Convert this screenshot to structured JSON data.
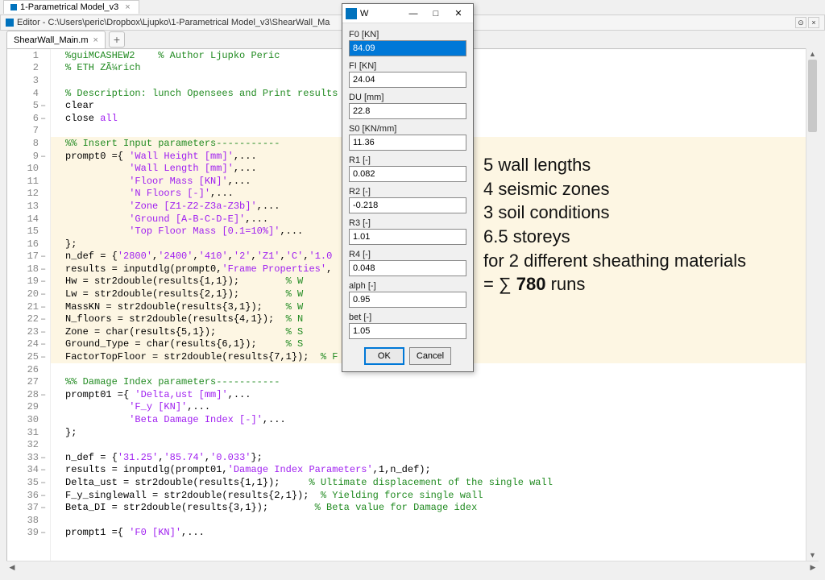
{
  "outerTab": "1-Parametrical Model_v3",
  "editor": {
    "title": "Editor - C:\\Users\\peric\\Dropbox\\Ljupko\\1-Parametrical Model_v3\\ShearWall_Ma",
    "restoreTip": "⊙",
    "closeTip": "×"
  },
  "fileTab": {
    "name": "ShearWall_Main.m",
    "close": "×",
    "plus": "+"
  },
  "code": [
    {
      "n": 1,
      "dash": false,
      "hl": false,
      "spans": [
        [
          "com",
          "%guiMCASHEW2    % Author Ljupko Peric"
        ]
      ]
    },
    {
      "n": 2,
      "dash": false,
      "hl": false,
      "spans": [
        [
          "com",
          "% ETH ZÃ¼rich"
        ]
      ]
    },
    {
      "n": 3,
      "dash": false,
      "hl": false,
      "spans": [
        [
          "txt",
          ""
        ]
      ]
    },
    {
      "n": 4,
      "dash": false,
      "hl": false,
      "spans": [
        [
          "com",
          "% Description: lunch Opensees and Print results"
        ]
      ]
    },
    {
      "n": 5,
      "dash": true,
      "hl": false,
      "spans": [
        [
          "txt",
          "clear"
        ]
      ]
    },
    {
      "n": 6,
      "dash": true,
      "hl": false,
      "spans": [
        [
          "txt",
          "close "
        ],
        [
          "str",
          "all"
        ]
      ]
    },
    {
      "n": 7,
      "dash": false,
      "hl": false,
      "spans": [
        [
          "txt",
          ""
        ]
      ]
    },
    {
      "n": 8,
      "dash": false,
      "hl": true,
      "spans": [
        [
          "com",
          "%% Insert Input parameters-----------"
        ]
      ]
    },
    {
      "n": 9,
      "dash": true,
      "hl": true,
      "spans": [
        [
          "txt",
          "prompt0 ={ "
        ],
        [
          "str",
          "'Wall Height [mm]'"
        ],
        [
          "txt",
          ",..."
        ]
      ]
    },
    {
      "n": 10,
      "dash": false,
      "hl": true,
      "spans": [
        [
          "txt",
          "           "
        ],
        [
          "str",
          "'Wall Length [mm]'"
        ],
        [
          "txt",
          ",..."
        ]
      ]
    },
    {
      "n": 11,
      "dash": false,
      "hl": true,
      "spans": [
        [
          "txt",
          "           "
        ],
        [
          "str",
          "'Floor Mass [KN]'"
        ],
        [
          "txt",
          ",..."
        ]
      ]
    },
    {
      "n": 12,
      "dash": false,
      "hl": true,
      "spans": [
        [
          "txt",
          "           "
        ],
        [
          "str",
          "'N Floors [-]'"
        ],
        [
          "txt",
          ",..."
        ]
      ]
    },
    {
      "n": 13,
      "dash": false,
      "hl": true,
      "spans": [
        [
          "txt",
          "           "
        ],
        [
          "str",
          "'Zone [Z1-Z2-Z3a-Z3b]'"
        ],
        [
          "txt",
          ",..."
        ]
      ]
    },
    {
      "n": 14,
      "dash": false,
      "hl": true,
      "spans": [
        [
          "txt",
          "           "
        ],
        [
          "str",
          "'Ground [A-B-C-D-E]'"
        ],
        [
          "txt",
          ",..."
        ]
      ]
    },
    {
      "n": 15,
      "dash": false,
      "hl": true,
      "spans": [
        [
          "txt",
          "           "
        ],
        [
          "str",
          "'Top Floor Mass [0.1=10%]'"
        ],
        [
          "txt",
          ",..."
        ]
      ]
    },
    {
      "n": 16,
      "dash": false,
      "hl": true,
      "spans": [
        [
          "txt",
          "};"
        ]
      ]
    },
    {
      "n": 17,
      "dash": true,
      "hl": true,
      "spans": [
        [
          "txt",
          "n_def = {"
        ],
        [
          "str",
          "'2800'"
        ],
        [
          "txt",
          ","
        ],
        [
          "str",
          "'2400'"
        ],
        [
          "txt",
          ","
        ],
        [
          "str",
          "'410'"
        ],
        [
          "txt",
          ","
        ],
        [
          "str",
          "'2'"
        ],
        [
          "txt",
          ","
        ],
        [
          "str",
          "'Z1'"
        ],
        [
          "txt",
          ","
        ],
        [
          "str",
          "'C'"
        ],
        [
          "txt",
          ","
        ],
        [
          "str",
          "'1.0"
        ]
      ]
    },
    {
      "n": 18,
      "dash": true,
      "hl": true,
      "spans": [
        [
          "txt",
          "results = inputdlg(prompt0,"
        ],
        [
          "str",
          "'Frame Properties'"
        ],
        [
          "txt",
          ","
        ]
      ]
    },
    {
      "n": 19,
      "dash": true,
      "hl": true,
      "spans": [
        [
          "txt",
          "Hw = str2double(results{1,1});        "
        ],
        [
          "com",
          "% W"
        ]
      ]
    },
    {
      "n": 20,
      "dash": true,
      "hl": true,
      "spans": [
        [
          "txt",
          "Lw = str2double(results{2,1});        "
        ],
        [
          "com",
          "% W"
        ]
      ]
    },
    {
      "n": 21,
      "dash": true,
      "hl": true,
      "spans": [
        [
          "txt",
          "MassKN = str2double(results{3,1});    "
        ],
        [
          "com",
          "% W"
        ]
      ]
    },
    {
      "n": 22,
      "dash": true,
      "hl": true,
      "spans": [
        [
          "txt",
          "N_floors = str2double(results{4,1});  "
        ],
        [
          "com",
          "% N"
        ]
      ]
    },
    {
      "n": 23,
      "dash": true,
      "hl": true,
      "spans": [
        [
          "txt",
          "Zone = char(results{5,1});            "
        ],
        [
          "com",
          "% S"
        ]
      ]
    },
    {
      "n": 24,
      "dash": true,
      "hl": true,
      "spans": [
        [
          "txt",
          "Ground_Type = char(results{6,1});     "
        ],
        [
          "com",
          "% S"
        ]
      ]
    },
    {
      "n": 25,
      "dash": true,
      "hl": true,
      "spans": [
        [
          "txt",
          "FactorTopFloor = str2double(results{7,1});  "
        ],
        [
          "com",
          "% F"
        ]
      ]
    },
    {
      "n": 26,
      "dash": false,
      "hl": false,
      "spans": [
        [
          "txt",
          ""
        ]
      ]
    },
    {
      "n": 27,
      "dash": false,
      "hl": false,
      "spans": [
        [
          "com",
          "%% Damage Index parameters-----------"
        ]
      ]
    },
    {
      "n": 28,
      "dash": true,
      "hl": false,
      "spans": [
        [
          "txt",
          "prompt01 ={ "
        ],
        [
          "str",
          "'Delta,ust [mm]'"
        ],
        [
          "txt",
          ",..."
        ]
      ]
    },
    {
      "n": 29,
      "dash": false,
      "hl": false,
      "spans": [
        [
          "txt",
          "           "
        ],
        [
          "str",
          "'F_y [KN]'"
        ],
        [
          "txt",
          ",..."
        ]
      ]
    },
    {
      "n": 30,
      "dash": false,
      "hl": false,
      "spans": [
        [
          "txt",
          "           "
        ],
        [
          "str",
          "'Beta Damage Index [-]'"
        ],
        [
          "txt",
          ",..."
        ]
      ]
    },
    {
      "n": 31,
      "dash": false,
      "hl": false,
      "spans": [
        [
          "txt",
          "};"
        ]
      ]
    },
    {
      "n": 32,
      "dash": false,
      "hl": false,
      "spans": [
        [
          "txt",
          ""
        ]
      ]
    },
    {
      "n": 33,
      "dash": true,
      "hl": false,
      "spans": [
        [
          "txt",
          "n_def = {"
        ],
        [
          "str",
          "'31.25'"
        ],
        [
          "txt",
          ","
        ],
        [
          "str",
          "'85.74'"
        ],
        [
          "txt",
          ","
        ],
        [
          "str",
          "'0.033'"
        ],
        [
          "txt",
          "};"
        ]
      ]
    },
    {
      "n": 34,
      "dash": true,
      "hl": false,
      "spans": [
        [
          "txt",
          "results = inputdlg(prompt01,"
        ],
        [
          "str",
          "'Damage Index Parameters'"
        ],
        [
          "txt",
          ",1,n_def);"
        ]
      ]
    },
    {
      "n": 35,
      "dash": true,
      "hl": false,
      "spans": [
        [
          "txt",
          "Delta_ust = str2double(results{1,1});     "
        ],
        [
          "com",
          "% Ultimate displacement of the single wall"
        ]
      ]
    },
    {
      "n": 36,
      "dash": true,
      "hl": false,
      "spans": [
        [
          "txt",
          "F_y_singlewall = str2double(results{2,1});  "
        ],
        [
          "com",
          "% Yielding force single wall"
        ]
      ]
    },
    {
      "n": 37,
      "dash": true,
      "hl": false,
      "spans": [
        [
          "txt",
          "Beta_DI = str2double(results{3,1});        "
        ],
        [
          "com",
          "% Beta value for Damage idex"
        ]
      ]
    },
    {
      "n": 38,
      "dash": false,
      "hl": false,
      "spans": [
        [
          "txt",
          ""
        ]
      ]
    },
    {
      "n": 39,
      "dash": true,
      "hl": false,
      "spans": [
        [
          "txt",
          "prompt1 ={ "
        ],
        [
          "str",
          "'F0 [KN]'"
        ],
        [
          "txt",
          ",..."
        ]
      ]
    }
  ],
  "overlay": {
    "l1": "5 wall lengths",
    "l2": "4 seismic zones",
    "l3": "3 soil conditions",
    "l4": "6.5 storeys",
    "l5": "for 2 different sheathing materials",
    "l6a": "= ∑ ",
    "l6b": "780",
    "l6c": " runs"
  },
  "dialog": {
    "title": "W",
    "fields": [
      {
        "label": "F0 [KN]",
        "value": "84.09",
        "sel": true
      },
      {
        "label": "FI [KN]",
        "value": "24.04"
      },
      {
        "label": "DU [mm]",
        "value": "22.8"
      },
      {
        "label": "S0 [KN/mm]",
        "value": "11.36"
      },
      {
        "label": "R1 [-]",
        "value": "0.082"
      },
      {
        "label": "R2 [-]",
        "value": "-0.218"
      },
      {
        "label": "R3 [-]",
        "value": "1.01"
      },
      {
        "label": "R4 [-]",
        "value": "0.048"
      },
      {
        "label": "alph [-]",
        "value": "0.95"
      },
      {
        "label": "bet [-]",
        "value": "1.05"
      }
    ],
    "ok": "OK",
    "cancel": "Cancel"
  }
}
